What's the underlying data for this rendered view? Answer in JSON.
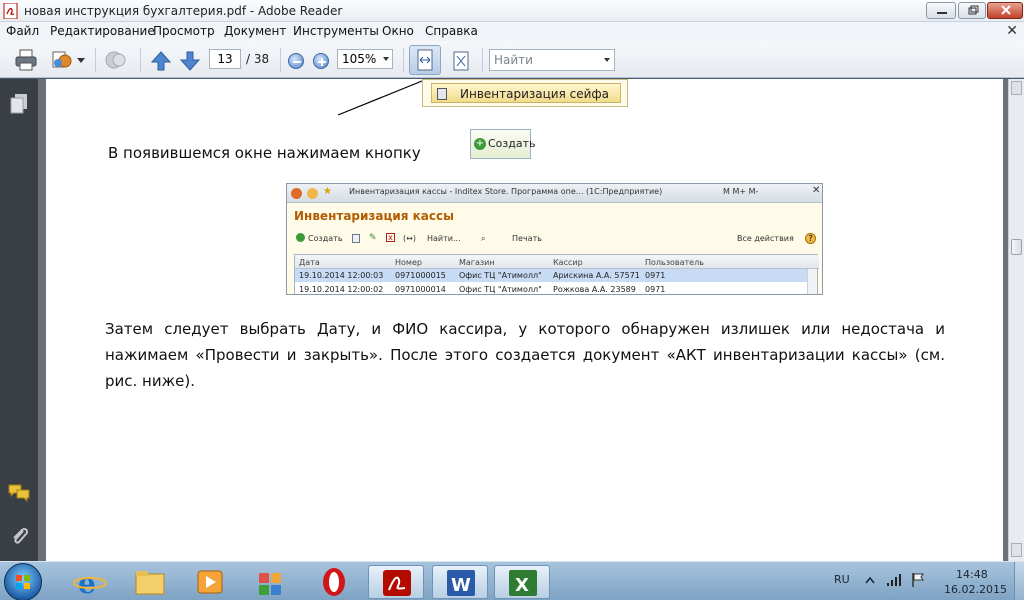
{
  "window": {
    "title": "новая инструкция бухгалтерия.pdf - Adobe Reader"
  },
  "menu": [
    "Файл",
    "Редактирование",
    "Просмотр",
    "Документ",
    "Инструменты",
    "Окно",
    "Справка"
  ],
  "toolbar": {
    "page_current": "13",
    "page_total": "/ 38",
    "zoom": "105%",
    "find_placeholder": "Найти"
  },
  "document": {
    "command_item": "Инвентаризация сейфа",
    "para1": "В появившемся окне нажимаем кнопку",
    "create_button": "Создать",
    "para2": "Затем следует выбрать Дату, и ФИО кассира, у которого обнаружен излишек или недостача и нажимаем «Провести и закрыть». После этого создается документ «АКТ инвентаризации кассы» (см. рис. ниже).",
    "screenshot": {
      "window_title": "Инвентаризация кассы - Inditex Store. Программа опе... (1С:Предприятие)",
      "title_right": "M  M+  M-",
      "heading": "Инвентаризация кассы",
      "tools": {
        "create": "Создать",
        "find": "Найти...",
        "print": "Печать",
        "all_actions": "Все действия"
      },
      "columns": [
        "Дата",
        "Номер",
        "Магазин",
        "Кассир",
        "Пользователь"
      ],
      "rows": [
        [
          "19.10.2014 12:00:03",
          "0971000015",
          "Офис ТЦ \"Атимолл\"",
          "Арискина А.А. 57571",
          "0971"
        ],
        [
          "19.10.2014 12:00:02",
          "0971000014",
          "Офис ТЦ \"Атимолл\"",
          "Рожкова А.А. 23589",
          "0971"
        ]
      ]
    }
  },
  "taskbar": {
    "language": "RU",
    "time": "14:48",
    "date": "16.02.2015"
  },
  "colors": {
    "heading_1c": "#b25d00",
    "taskbar": "#8fb0d0",
    "left_panel": "#3a3f46"
  }
}
